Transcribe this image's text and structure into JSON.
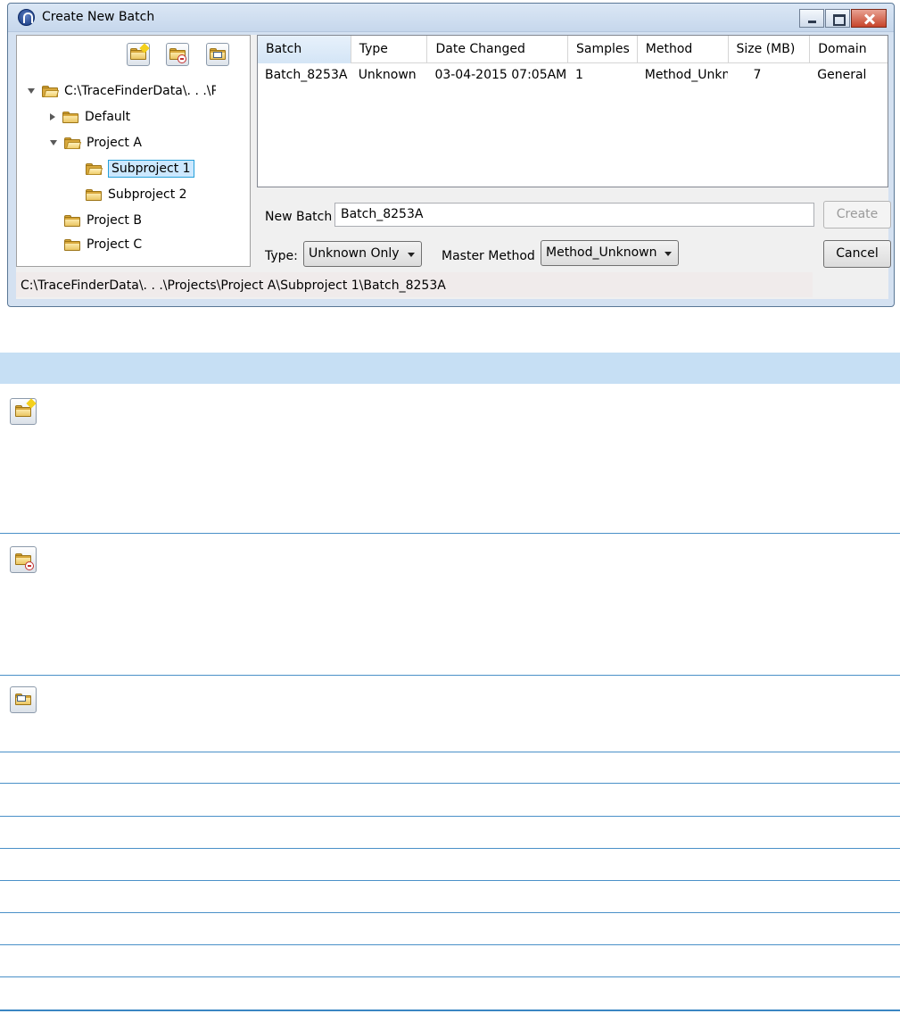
{
  "window": {
    "title": "Create New Batch"
  },
  "tree": {
    "root_label": "C:\\TraceFinderData\\. . .\\Projects",
    "items": [
      {
        "label": "Default"
      },
      {
        "label": "Project A"
      },
      {
        "label": "Subproject 1"
      },
      {
        "label": "Subproject 2"
      },
      {
        "label": "Project B"
      },
      {
        "label": "Project C"
      }
    ]
  },
  "grid": {
    "columns": [
      "Batch",
      "Type",
      "Date Changed",
      "Samples",
      "Method",
      "Size (MB)",
      "Domain"
    ],
    "rows": [
      [
        "Batch_8253A",
        "Unknown",
        "03-04-2015 07:05AM",
        "1",
        "Method_Unknr",
        "7",
        "General"
      ]
    ]
  },
  "form": {
    "new_batch_label": "New Batch",
    "new_batch_value": "Batch_8253A",
    "type_label": "Type:",
    "type_value": "Unknown Only",
    "master_method_label": "Master Method",
    "master_method_value": "Method_Unknown",
    "create_label": "Create",
    "cancel_label": "Cancel"
  },
  "status": {
    "path": "C:\\TraceFinderData\\. . .\\Projects\\Project A\\Subproject 1\\Batch_8253A"
  },
  "icons": {
    "new_project": "folder-new-icon",
    "delete_project": "folder-delete-icon",
    "batch_properties": "folder-properties-icon"
  },
  "colors": {
    "window_frame": "#d4e1f1",
    "selection": "#cce8ff",
    "selection_border": "#26a0da",
    "doc_header": "#c6dff4",
    "doc_rule": "#4a90c8"
  }
}
